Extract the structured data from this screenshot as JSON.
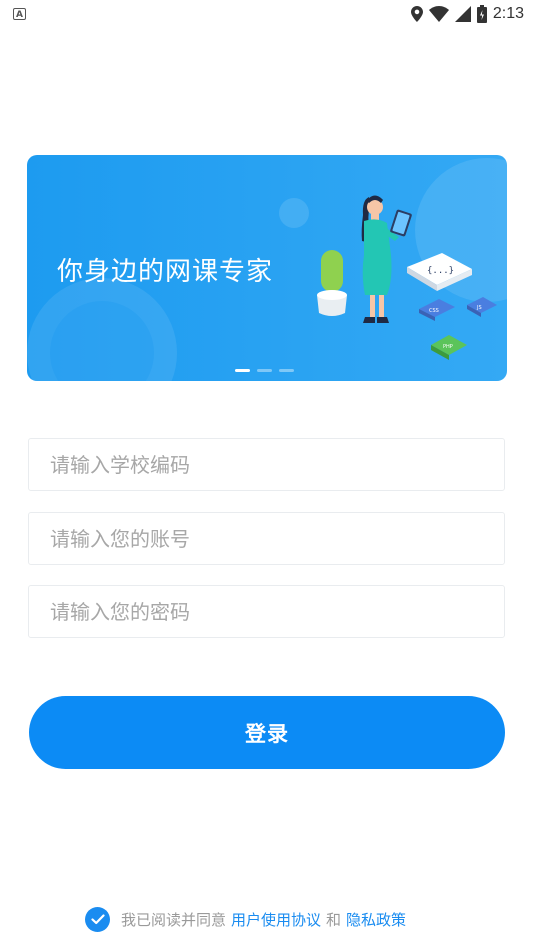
{
  "status_bar": {
    "left_icon_label": "A",
    "time": "2:13",
    "icons": [
      "location-icon",
      "wifi-icon",
      "signal-icon",
      "battery-icon"
    ]
  },
  "banner": {
    "title": "你身边的网课专家",
    "dots_count": 3,
    "active_dot": 0,
    "illustration_labels": [
      "CSS",
      "JS",
      "PHP"
    ]
  },
  "form": {
    "school_code_placeholder": "请输入学校编码",
    "account_placeholder": "请输入您的账号",
    "password_placeholder": "请输入您的密码",
    "login_label": "登录"
  },
  "agreement": {
    "checked": true,
    "prefix": "我已阅读并同意",
    "user_agreement": "用户使用协议",
    "and": "和",
    "privacy_policy": "隐私政策"
  },
  "colors": {
    "primary": "#0c8bf5",
    "banner": "#1d9bf0",
    "placeholder": "#a7a7a7",
    "link": "#1a8cf0"
  }
}
